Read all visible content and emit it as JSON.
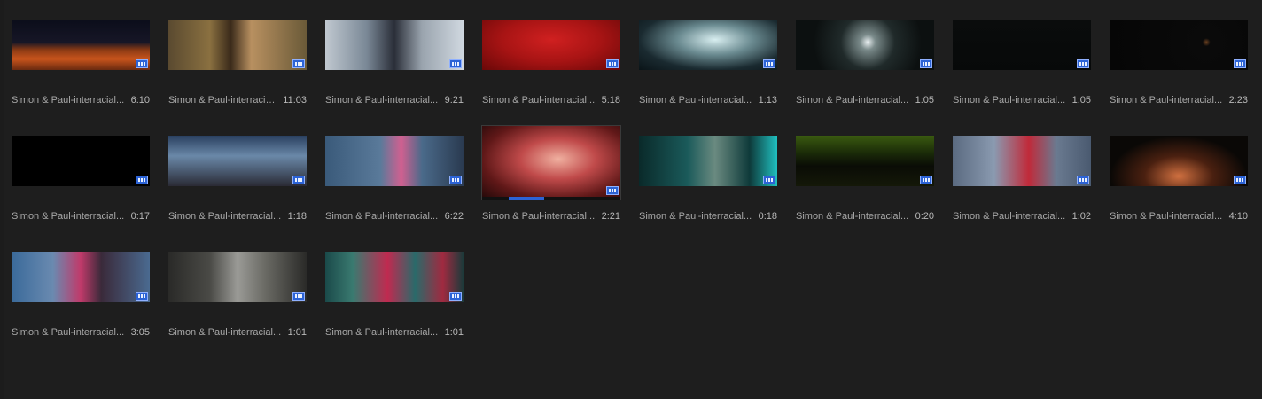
{
  "clips": [
    {
      "name": "Simon & Paul-interracial...",
      "duration": "6:10"
    },
    {
      "name": "Simon & Paul-interracia...",
      "duration": "11:03"
    },
    {
      "name": "Simon & Paul-interracial...",
      "duration": "9:21"
    },
    {
      "name": "Simon & Paul-interracial...",
      "duration": "5:18"
    },
    {
      "name": "Simon & Paul-interracial...",
      "duration": "1:13"
    },
    {
      "name": "Simon & Paul-interracial...",
      "duration": "1:05"
    },
    {
      "name": "Simon & Paul-interracial...",
      "duration": "1:05"
    },
    {
      "name": "Simon & Paul-interracial...",
      "duration": "2:23"
    },
    {
      "name": "Simon & Paul-interracial...",
      "duration": "0:17"
    },
    {
      "name": "Simon & Paul-interracial...",
      "duration": "1:18"
    },
    {
      "name": "Simon & Paul-interracial...",
      "duration": "6:22"
    },
    {
      "name": "Simon & Paul-interracial...",
      "duration": "2:21"
    },
    {
      "name": "Simon & Paul-interracial...",
      "duration": "0:18"
    },
    {
      "name": "Simon & Paul-interracial...",
      "duration": "0:20"
    },
    {
      "name": "Simon & Paul-interracial...",
      "duration": "1:02"
    },
    {
      "name": "Simon & Paul-interracial...",
      "duration": "4:10"
    },
    {
      "name": "Simon & Paul-interracial...",
      "duration": "3:05"
    },
    {
      "name": "Simon & Paul-interracial...",
      "duration": "1:01"
    },
    {
      "name": "Simon & Paul-interracial...",
      "duration": "1:01"
    }
  ],
  "selected_index": 11,
  "badge_icon": "video-clip-icon",
  "colors": {
    "panel_bg": "#1e1e1e",
    "text": "#a8a8a8",
    "badge": "#2c63d6"
  }
}
